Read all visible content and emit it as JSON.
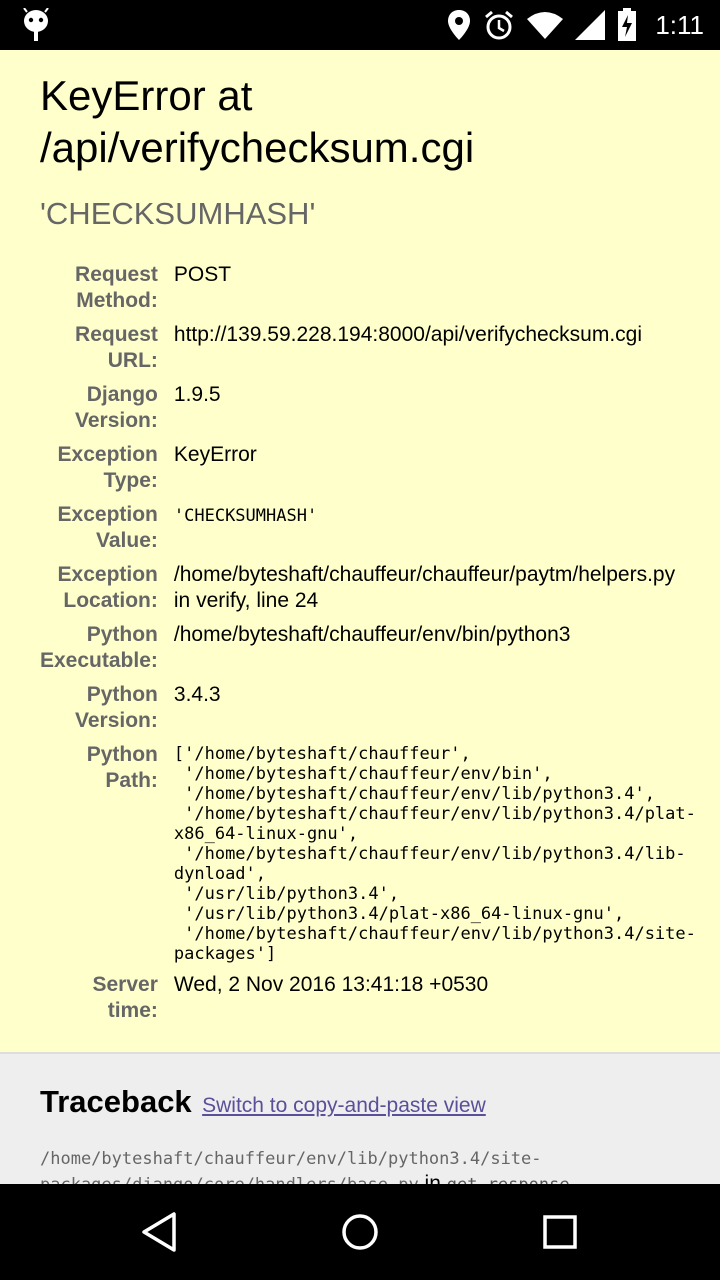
{
  "status_bar": {
    "time": "1:11",
    "icons": [
      "android-debug-icon",
      "location-icon",
      "alarm-icon",
      "wifi-icon",
      "signal-icon",
      "battery-charging-icon"
    ]
  },
  "page": {
    "title_line1": "KeyError at",
    "title_line2": "/api/verifychecksum.cgi",
    "exception_value_heading": "'CHECKSUMHASH'",
    "meta": {
      "request_method_label_1": "Request",
      "request_method_label_2": "Method:",
      "request_method": "POST",
      "request_url_label_1": "Request",
      "request_url_label_2": "URL:",
      "request_url": "http://139.59.228.194:8000/api/verifychecksum.cgi",
      "django_version_label_1": "Django",
      "django_version_label_2": "Version:",
      "django_version": "1.9.5",
      "exception_type_label_1": "Exception",
      "exception_type_label_2": "Type:",
      "exception_type": "KeyError",
      "exception_value_label_1": "Exception",
      "exception_value_label_2": "Value:",
      "exception_value": "'CHECKSUMHASH'",
      "exception_location_label_1": "Exception",
      "exception_location_label_2": "Location:",
      "exception_location_line1": "/home/byteshaft/chauffeur/chauffeur/paytm/helpers.py",
      "exception_location_line2": "in verify, line 24",
      "python_executable_label_1": "Python",
      "python_executable_label_2": "Executable:",
      "python_executable": "/home/byteshaft/chauffeur/env/bin/python3",
      "python_version_label_1": "Python",
      "python_version_label_2": "Version:",
      "python_version": "3.4.3",
      "python_path_label_1": "Python",
      "python_path_label_2": "Path:",
      "python_path_lines": [
        "['/home/byteshaft/chauffeur',",
        " '/home/byteshaft/chauffeur/env/bin',",
        " '/home/byteshaft/chauffeur/env/lib/python3.4',",
        " '/home/byteshaft/chauffeur/env/lib/python3.4/plat-",
        "x86_64-linux-gnu',",
        " '/home/byteshaft/chauffeur/env/lib/python3.4/lib-",
        "dynload',",
        " '/usr/lib/python3.4',",
        " '/usr/lib/python3.4/plat-x86_64-linux-gnu',",
        " '/home/byteshaft/chauffeur/env/lib/python3.4/site-",
        "packages']"
      ],
      "server_time_label_1": "Server",
      "server_time_label_2": "time:",
      "server_time": "Wed, 2 Nov 2016 13:41:18 +0530"
    },
    "traceback": {
      "heading": "Traceback",
      "switch_link": "Switch to copy-and-paste view",
      "frame_file_line1": "/home/byteshaft/chauffeur/env/lib/python3.4/site-",
      "frame_file_line2": "packages/django/core/handlers/base.py",
      "frame_in": "in",
      "frame_function": "get_response"
    }
  },
  "nav_bar": {
    "buttons": [
      "back-icon",
      "home-icon",
      "recents-icon"
    ]
  },
  "colors": {
    "summary_bg": "#ffffcc",
    "traceback_bg": "#eeeeee",
    "label_gray": "#666666",
    "link": "#5b4f99"
  }
}
